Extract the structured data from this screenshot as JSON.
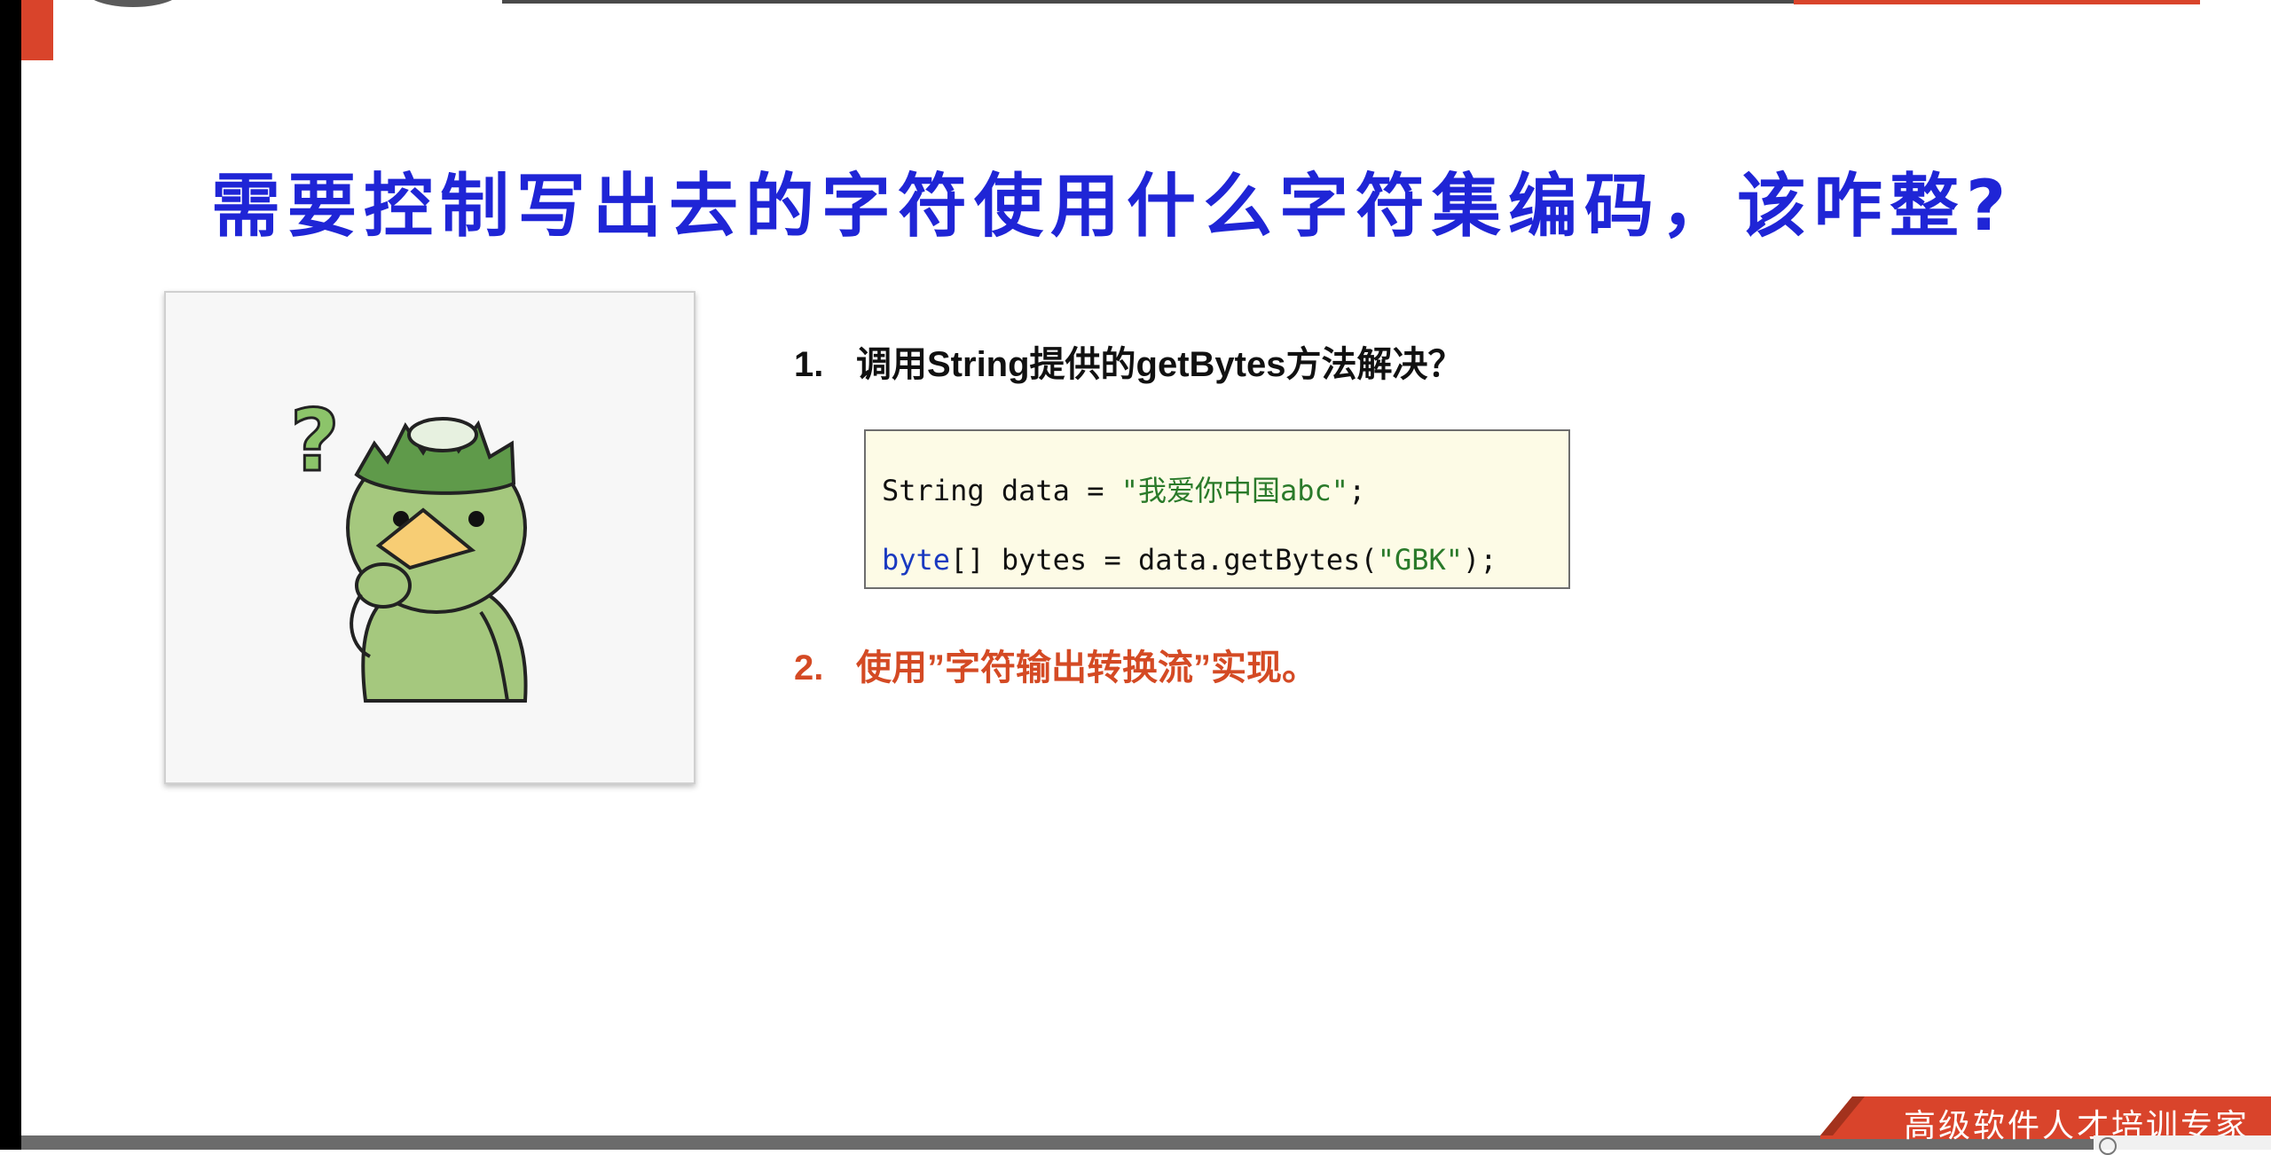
{
  "slide": {
    "title": "需要控制写出去的字符使用什么字符集编码，该咋整?",
    "item1": {
      "number": "1.",
      "text": "调用String提供的getBytes方法解决？"
    },
    "code": {
      "line1": {
        "prefix": "String data = ",
        "string": "\"我爱你中国abc\"",
        "suffix": ";"
      },
      "line2": {
        "keyword": "byte",
        "middle": "[] bytes = data.getBytes(",
        "string": "\"GBK\"",
        "suffix": ");"
      }
    },
    "item2": {
      "number": "2.",
      "text": "使用”字符输出转换流”实现。"
    },
    "illustration": "confused-kappa-character"
  },
  "footer": {
    "banner_text": "高级软件人才培训专家"
  },
  "colors": {
    "title": "#1f25d6",
    "accent": "#d9442b",
    "item2_text": "#d44a24",
    "code_bg": "#fdfbe6",
    "code_keyword": "#1a3ac0",
    "code_string": "#2a7a2a"
  }
}
